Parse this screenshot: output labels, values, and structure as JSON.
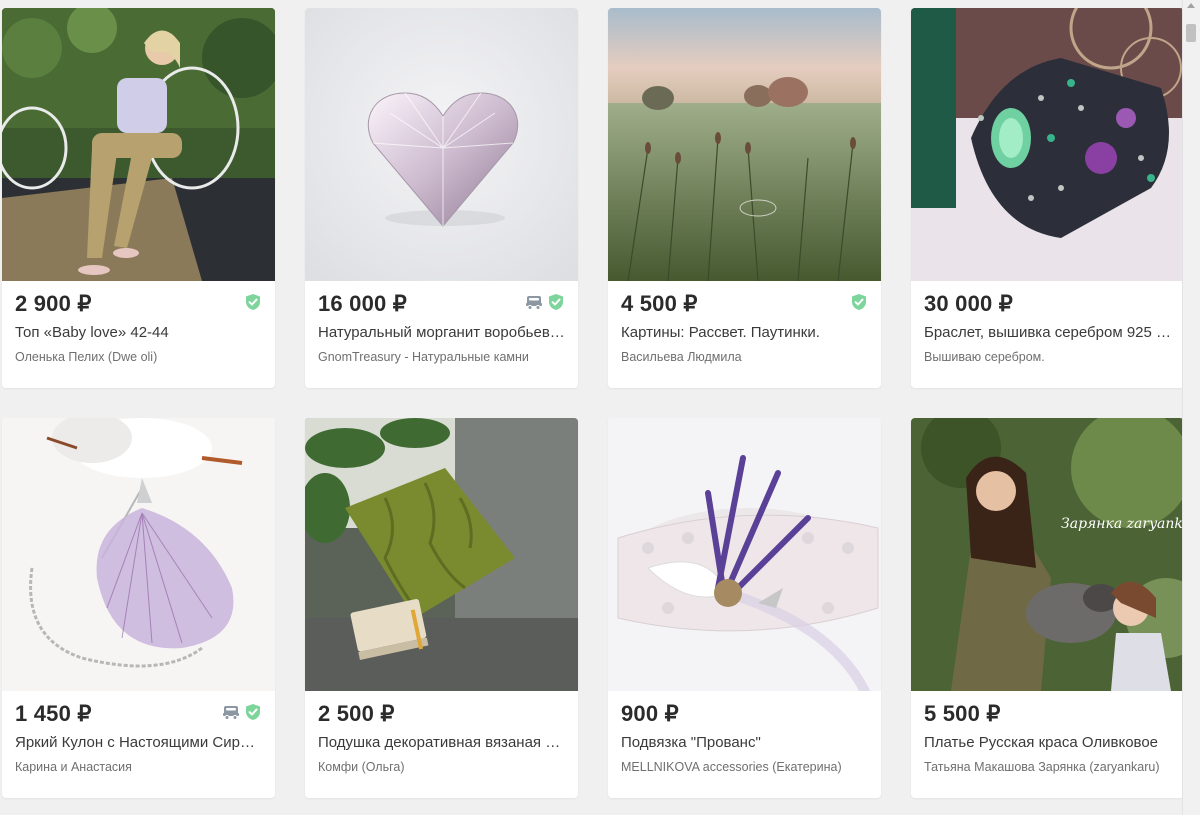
{
  "products": [
    {
      "price": "2 900 ₽",
      "title": "Топ «Baby love» 42-44",
      "shop": "Оленька Пелих (Dwe oli)",
      "image": "woman-in-white-top-photo",
      "delivery": false,
      "verified": true
    },
    {
      "price": "16 000 ₽",
      "title": "Натуральный морганит воробьев…",
      "shop": "GnomTreasury - Натуральные камни",
      "image": "heart-gemstone-photo",
      "delivery": true,
      "verified": true
    },
    {
      "price": "4 500 ₽",
      "title": "Картины: Рассвет. Паутинки.",
      "shop": "Васильева Людмила",
      "image": "meadow-painting-photo",
      "delivery": false,
      "verified": true
    },
    {
      "price": "30 000 ₽",
      "title": "Браслет, вышивка серебром 925 …",
      "shop": "Вышиваю серебром.",
      "image": "embroidered-bracelet-photo",
      "delivery": false,
      "verified": false
    },
    {
      "price": "1 450 ₽",
      "title": "Яркий Кулон с Настоящими Сире…",
      "shop": "Карина и Анастасия",
      "image": "lilac-pendant-photo",
      "delivery": true,
      "verified": true
    },
    {
      "price": "2 500 ₽",
      "title": "Подушка декоративная вязаная …",
      "shop": "Комфи (Ольга)",
      "image": "knitted-pillow-photo",
      "delivery": false,
      "verified": false
    },
    {
      "price": "900 ₽",
      "title": "Подвязка \"Прованс\"",
      "shop": "MELLNIKOVA accessories (Екатерина)",
      "image": "lavender-garter-photo",
      "delivery": false,
      "verified": false
    },
    {
      "price": "5 500 ₽",
      "title": "Платье Русская краса Оливковое",
      "shop": "Татьяна Макашова Зарянка (zaryankaru)",
      "image": "olive-dress-photo",
      "delivery": false,
      "verified": false
    }
  ],
  "colors": {
    "page_bg": "#f1f0f0",
    "card_bg": "#ffffff",
    "price_text": "#2b2b2b",
    "verified_badge": "#7ed59b",
    "delivery_badge": "#8b97a3"
  },
  "icons": {
    "delivery": "truck-icon",
    "verified": "shield-check-icon"
  },
  "watermark": "Зарянка zaryankaru"
}
